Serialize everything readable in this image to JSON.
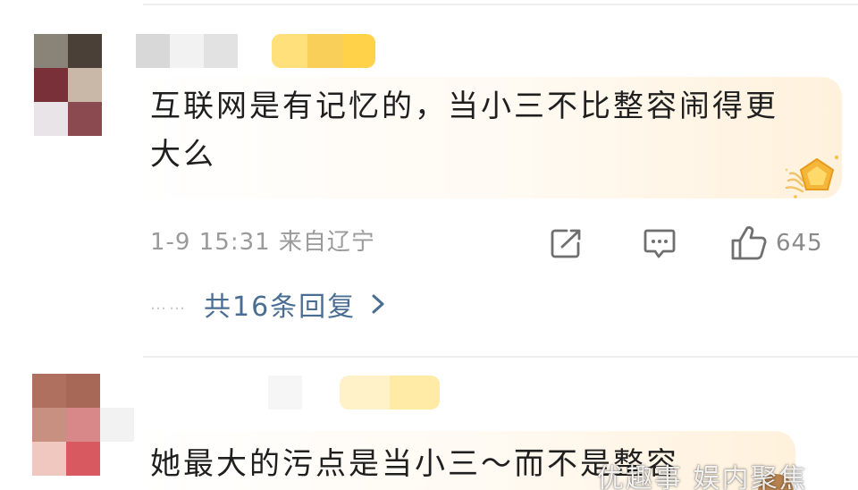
{
  "comments": [
    {
      "text": "互联网是有记忆的，当小三不比整容闹得更大么",
      "meta": "1-9 15:31 来自辽宁",
      "like_count": "645",
      "replies_label": "共16条回复",
      "replies_dots": "……",
      "icons": {
        "share": "share-icon",
        "comment": "comment-icon",
        "like": "thumbs-up-icon",
        "badge": "gold-pentagon-badge-icon",
        "chevron": "chevron-right-icon"
      }
    },
    {
      "text": "她最大的污点是当小三～而不是整容"
    }
  ],
  "watermark": {
    "text": "优趣事 娱内聚焦"
  },
  "colors": {
    "text": "#1f1f1f",
    "meta": "#9a9a9a",
    "link": "#4a6d93",
    "card_gradient_end": "#fff1dc",
    "badge_gold": "#f4b73a"
  }
}
